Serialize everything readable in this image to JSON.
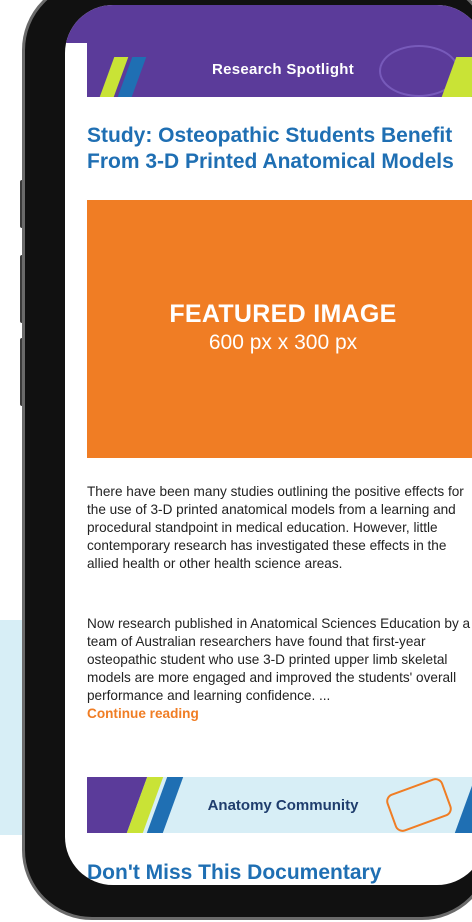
{
  "banner_top": {
    "label": "Research Spotlight"
  },
  "article": {
    "title": "Study: Osteopathic Students Benefit From 3-D Printed Anatomical Models",
    "featured_image": {
      "title": "FEATURED IMAGE",
      "size": "600 px x 300 px"
    },
    "paragraph1": "There have been many studies outlining the positive effects for the use of 3-D printed anatomical models from a learning and procedural standpoint in medical education. However, little contemporary research has investigated these effects in the allied health or other health science areas.",
    "paragraph2": "Now research published in Anatomical Sciences Education by a team of Australian researchers have found that first-year osteopathic student who use 3-D printed upper limb skeletal models are more engaged and improved the students' overall performance and learning confidence. ...",
    "continue_label": "Continue reading"
  },
  "banner_community": {
    "label": "Anatomy Community"
  },
  "next_article": {
    "title": "Don't Miss This Documentary Screening at Anatomy Connected"
  },
  "colors": {
    "primary": "#1f6fb3",
    "accent": "#f07d24",
    "purple": "#5b3b9a",
    "lime": "#c9e336"
  }
}
